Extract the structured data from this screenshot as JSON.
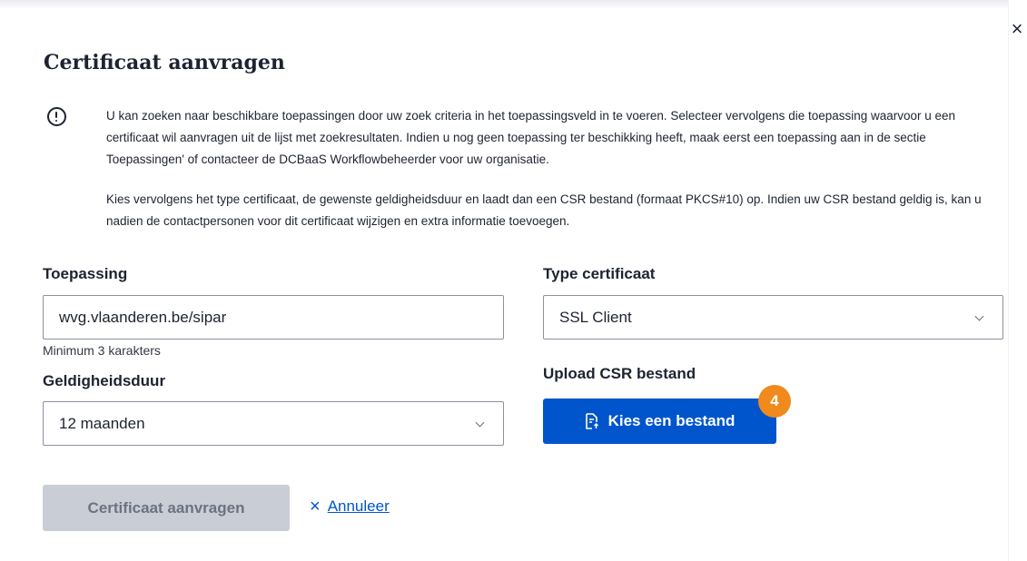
{
  "dialog": {
    "title": "Certificaat aanvragen",
    "close_label": "×",
    "intro": [
      "U kan zoeken naar beschikbare toepassingen door uw zoek criteria in het toepassingsveld in te voeren. Selecteer vervolgens die toepassing waarvoor u een certificaat wil aanvragen uit de lijst met zoekresultaten. Indien u nog geen toepassing ter beschikking heeft, maak eerst een toepassing aan in de sectie Toepassingen' of contacteer de DCBaaS Workflowbeheerder voor uw organisatie.",
      "Kies vervolgens het type certificaat, de gewenste geldigheidsduur en laadt dan een CSR bestand (formaat PKCS#10) op. Indien uw CSR bestand geldig is, kan u nadien de contactpersonen voor dit certificaat wijzigen en extra informatie toevoegen."
    ]
  },
  "form": {
    "toepassing": {
      "label": "Toepassing",
      "value": "wvg.vlaanderen.be/sipar",
      "hint": "Minimum 3 karakters"
    },
    "type": {
      "label": "Type certificaat",
      "value": "SSL Client"
    },
    "geldigheid": {
      "label": "Geldigheidsduur",
      "value": "12 maanden"
    },
    "upload": {
      "label": "Upload CSR bestand",
      "button_label": "Kies een bestand",
      "badge": "4"
    }
  },
  "actions": {
    "submit_label": "Certificaat aanvragen",
    "cancel_icon": "×",
    "cancel_label": "Annuleer"
  },
  "colors": {
    "primary": "#0055cc",
    "badge": "#f08a1c",
    "disabled_bg": "#c9ced6",
    "text": "#1d2330"
  }
}
